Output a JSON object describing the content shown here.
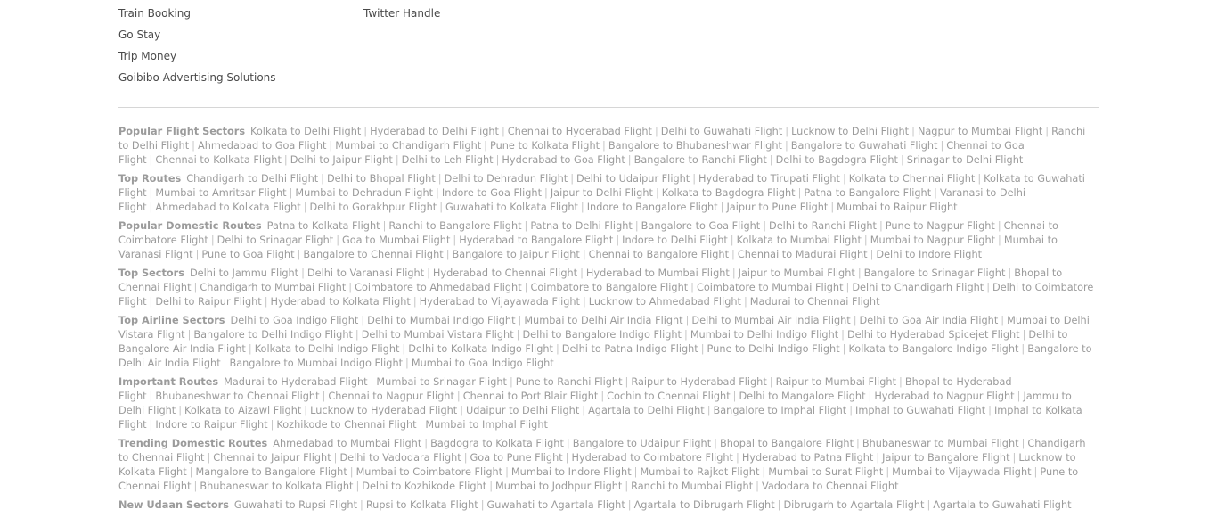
{
  "footer_columns": [
    [
      "Train Booking",
      "Go Stay",
      "Trip Money",
      "Goibibo Advertising Solutions"
    ],
    [
      "Twitter Handle"
    ]
  ],
  "sectors": [
    {
      "title": "Popular Flight Sectors",
      "links": [
        "Kolkata to Delhi Flight",
        "Hyderabad to Delhi Flight",
        "Chennai to Hyderabad Flight",
        "Delhi to Guwahati Flight",
        "Lucknow to Delhi Flight",
        "Nagpur to Mumbai Flight",
        "Ranchi to Delhi Flight",
        "Ahmedabad to Goa Flight",
        "Mumbai to Chandigarh Flight",
        "Pune to Kolkata Flight",
        "Bangalore to Bhubaneshwar Flight",
        "Bangalore to Guwahati Flight",
        "Chennai to Goa Flight",
        "Chennai to Kolkata Flight",
        "Delhi to Jaipur Flight",
        "Delhi to Leh Flight",
        "Hyderabad to Goa Flight",
        "Bangalore to Ranchi Flight",
        "Delhi to Bagdogra Flight",
        "Srinagar to Delhi Flight"
      ]
    },
    {
      "title": "Top Routes",
      "links": [
        "Chandigarh to Delhi Flight",
        "Delhi to Bhopal Flight",
        "Delhi to Dehradun Flight",
        "Delhi to Udaipur Flight",
        "Hyderabad to Tirupati Flight",
        "Kolkata to Chennai Flight",
        "Kolkata to Guwahati Flight",
        "Mumbai to Amritsar Flight",
        "Mumbai to Dehradun Flight",
        "Indore to Goa Flight",
        "Jaipur to Delhi Flight",
        "Kolkata to Bagdogra Flight",
        "Patna to Bangalore Flight",
        "Varanasi to Delhi Flight",
        "Ahmedabad to Kolkata Flight",
        "Delhi to Gorakhpur Flight",
        "Guwahati to Kolkata Flight",
        "Indore to Bangalore Flight",
        "Jaipur to Pune Flight",
        "Mumbai to Raipur Flight"
      ]
    },
    {
      "title": "Popular Domestic Routes",
      "links": [
        "Patna to Kolkata Flight",
        "Ranchi to Bangalore Flight",
        "Patna to Delhi Flight",
        "Bangalore to Goa Flight",
        "Delhi to Ranchi Flight",
        "Pune to Nagpur Flight",
        "Chennai to Coimbatore Flight",
        "Delhi to Srinagar Flight",
        "Goa to Mumbai Flight",
        "Hyderabad to Bangalore Flight",
        "Indore to Delhi Flight",
        "Kolkata to Mumbai Flight",
        "Mumbai to Nagpur Flight",
        "Mumbai to Varanasi Flight",
        "Pune to Goa Flight",
        "Bangalore to Chennai Flight",
        "Bangalore to Jaipur Flight",
        "Chennai to Bangalore Flight",
        "Chennai to Madurai Flight",
        "Delhi to Indore Flight"
      ]
    },
    {
      "title": "Top Sectors",
      "links": [
        "Delhi to Jammu Flight",
        "Delhi to Varanasi Flight",
        "Hyderabad to Chennai Flight",
        "Hyderabad to Mumbai Flight",
        "Jaipur to Mumbai Flight",
        "Bangalore to Srinagar Flight",
        "Bhopal to Chennai Flight",
        "Chandigarh to Mumbai Flight",
        "Coimbatore to Ahmedabad Flight",
        "Coimbatore to Bangalore Flight",
        "Coimbatore to Mumbai Flight",
        "Delhi to Chandigarh Flight",
        "Delhi to Coimbatore Flight",
        "Delhi to Raipur Flight",
        "Hyderabad to Kolkata Flight",
        "Hyderabad to Vijayawada Flight",
        "Lucknow to Ahmedabad Flight",
        "Madurai to Chennai Flight"
      ]
    },
    {
      "title": "Top Airline Sectors",
      "links": [
        "Delhi to Goa Indigo Flight",
        "Delhi to Mumbai Indigo Flight",
        "Mumbai to Delhi Air India Flight",
        "Delhi to Mumbai Air India Flight",
        "Delhi to Goa Air India Flight",
        "Mumbai to Delhi Vistara Flight",
        "Bangalore to Delhi Indigo Flight",
        "Delhi to Mumbai Vistara Flight",
        "Delhi to Bangalore Indigo Flight",
        "Mumbai to Delhi Indigo Flight",
        "Delhi to Hyderabad Spicejet Flight",
        "Delhi to Bangalore Air India Flight",
        "Kolkata to Delhi Indigo Flight",
        "Delhi to Kolkata Indigo Flight",
        "Delhi to Patna Indigo Flight",
        "Pune to Delhi Indigo Flight",
        "Kolkata to Bangalore Indigo Flight",
        "Bangalore to Delhi Air India Flight",
        "Bangalore to Mumbai Indigo Flight",
        "Mumbai to Goa Indigo Flight"
      ]
    },
    {
      "title": "Important Routes",
      "links": [
        "Madurai to Hyderabad Flight",
        "Mumbai to Srinagar Flight",
        "Pune to Ranchi Flight",
        "Raipur to Hyderabad Flight",
        "Raipur to Mumbai Flight",
        "Bhopal to Hyderabad Flight",
        "Bhubaneshwar to Chennai Flight",
        "Chennai to Nagpur Flight",
        "Chennai to Port Blair Flight",
        "Cochin to Chennai Flight",
        "Delhi to Mangalore Flight",
        "Hyderabad to Nagpur Flight",
        "Jammu to Delhi Flight",
        "Kolkata to Aizawl Flight",
        "Lucknow to Hyderabad Flight",
        "Udaipur to Delhi Flight",
        "Agartala to Delhi Flight",
        "Bangalore to Imphal Flight",
        "Imphal to Guwahati Flight",
        "Imphal to Kolkata Flight",
        "Indore to Raipur Flight",
        "Kozhikode to Chennai Flight",
        "Mumbai to Imphal Flight"
      ]
    },
    {
      "title": "Trending Domestic Routes",
      "links": [
        "Ahmedabad to Mumbai Flight",
        "Bagdogra to Kolkata Flight",
        "Bangalore to Udaipur Flight",
        "Bhopal to Bangalore Flight",
        "Bhubaneswar to Mumbai Flight",
        "Chandigarh to Chennai Flight",
        "Chennai to Jaipur Flight",
        "Delhi to Vadodara Flight",
        "Goa to Pune Flight",
        "Hyderabad to Coimbatore Flight",
        "Hyderabad to Patna Flight",
        "Jaipur to Bangalore Flight",
        "Lucknow to Kolkata Flight",
        "Mangalore to Bangalore Flight",
        "Mumbai to Coimbatore Flight",
        "Mumbai to Indore Flight",
        "Mumbai to Rajkot Flight",
        "Mumbai to Surat Flight",
        "Mumbai to Vijaywada Flight",
        "Pune to Chennai Flight",
        "Bhubaneswar to Kolkata Flight",
        "Delhi to Kozhikode Flight",
        "Mumbai to Jodhpur Flight",
        "Ranchi to Mumbai Flight",
        "Vadodara to Chennai Flight"
      ]
    },
    {
      "title": "New Udaan Sectors",
      "links": [
        "Guwahati to Rupsi Flight",
        "Rupsi to Kolkata Flight",
        "Guwahati to Agartala Flight",
        "Agartala to Dibrugarh Flight",
        "Dibrugarh to Agartala Flight",
        "Agartala to Guwahati Flight"
      ]
    }
  ]
}
